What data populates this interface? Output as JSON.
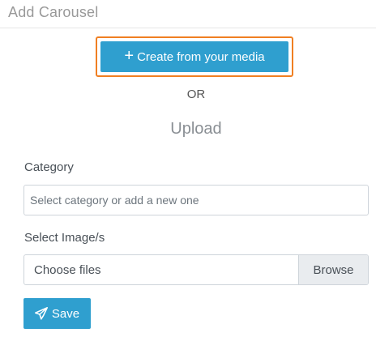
{
  "header": {
    "title": "Add Carousel"
  },
  "create_button": {
    "icon": "plus-icon",
    "label": "Create from your media"
  },
  "separator": "OR",
  "upload": {
    "heading": "Upload"
  },
  "category": {
    "label": "Category",
    "placeholder": "Select category or add a new one",
    "value": ""
  },
  "images": {
    "label": "Select Image/s",
    "file_text": "Choose files",
    "browse_label": "Browse"
  },
  "save_button": {
    "icon": "paper-plane-icon",
    "label": "Save"
  },
  "colors": {
    "primary": "#2f9fcf",
    "highlight": "#f07f22"
  }
}
